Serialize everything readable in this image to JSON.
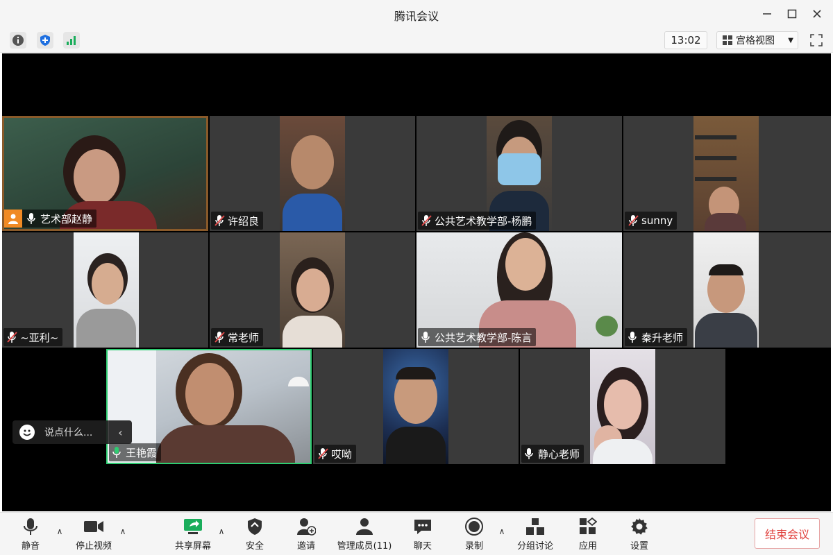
{
  "window": {
    "title": "腾讯会议"
  },
  "topbar": {
    "time": "13:02",
    "view_label": "宫格视图"
  },
  "participants": [
    {
      "name": "艺术部赵静",
      "mic": "on",
      "host": true
    },
    {
      "name": "许绍良",
      "mic": "muted"
    },
    {
      "name": "公共艺术教学部-杨鹏",
      "mic": "muted"
    },
    {
      "name": "sunny",
      "mic": "muted"
    },
    {
      "name": "~亚利~",
      "mic": "muted"
    },
    {
      "name": "常老师",
      "mic": "muted"
    },
    {
      "name": "公共艺术教学部-陈言",
      "mic": "on"
    },
    {
      "name": "秦升老师",
      "mic": "on"
    },
    {
      "name": "王艳霞",
      "mic": "speaking"
    },
    {
      "name": "哎呦",
      "mic": "muted"
    },
    {
      "name": "静心老师",
      "mic": "on"
    }
  ],
  "chat": {
    "placeholder": "说点什么..."
  },
  "toolbar": {
    "mute": "静音",
    "stop_video": "停止视频",
    "share_screen": "共享屏幕",
    "security": "安全",
    "invite": "邀请",
    "members": "管理成员(11)",
    "chat": "聊天",
    "record": "录制",
    "breakout": "分组讨论",
    "apps": "应用",
    "settings": "设置",
    "end": "结束会议"
  },
  "colors": {
    "speaking_border": "#2ecc71",
    "host_badge": "#f08a24",
    "end_button": "#e0413d",
    "share_green": "#1aad5b",
    "security_blue": "#1e6fe0"
  }
}
